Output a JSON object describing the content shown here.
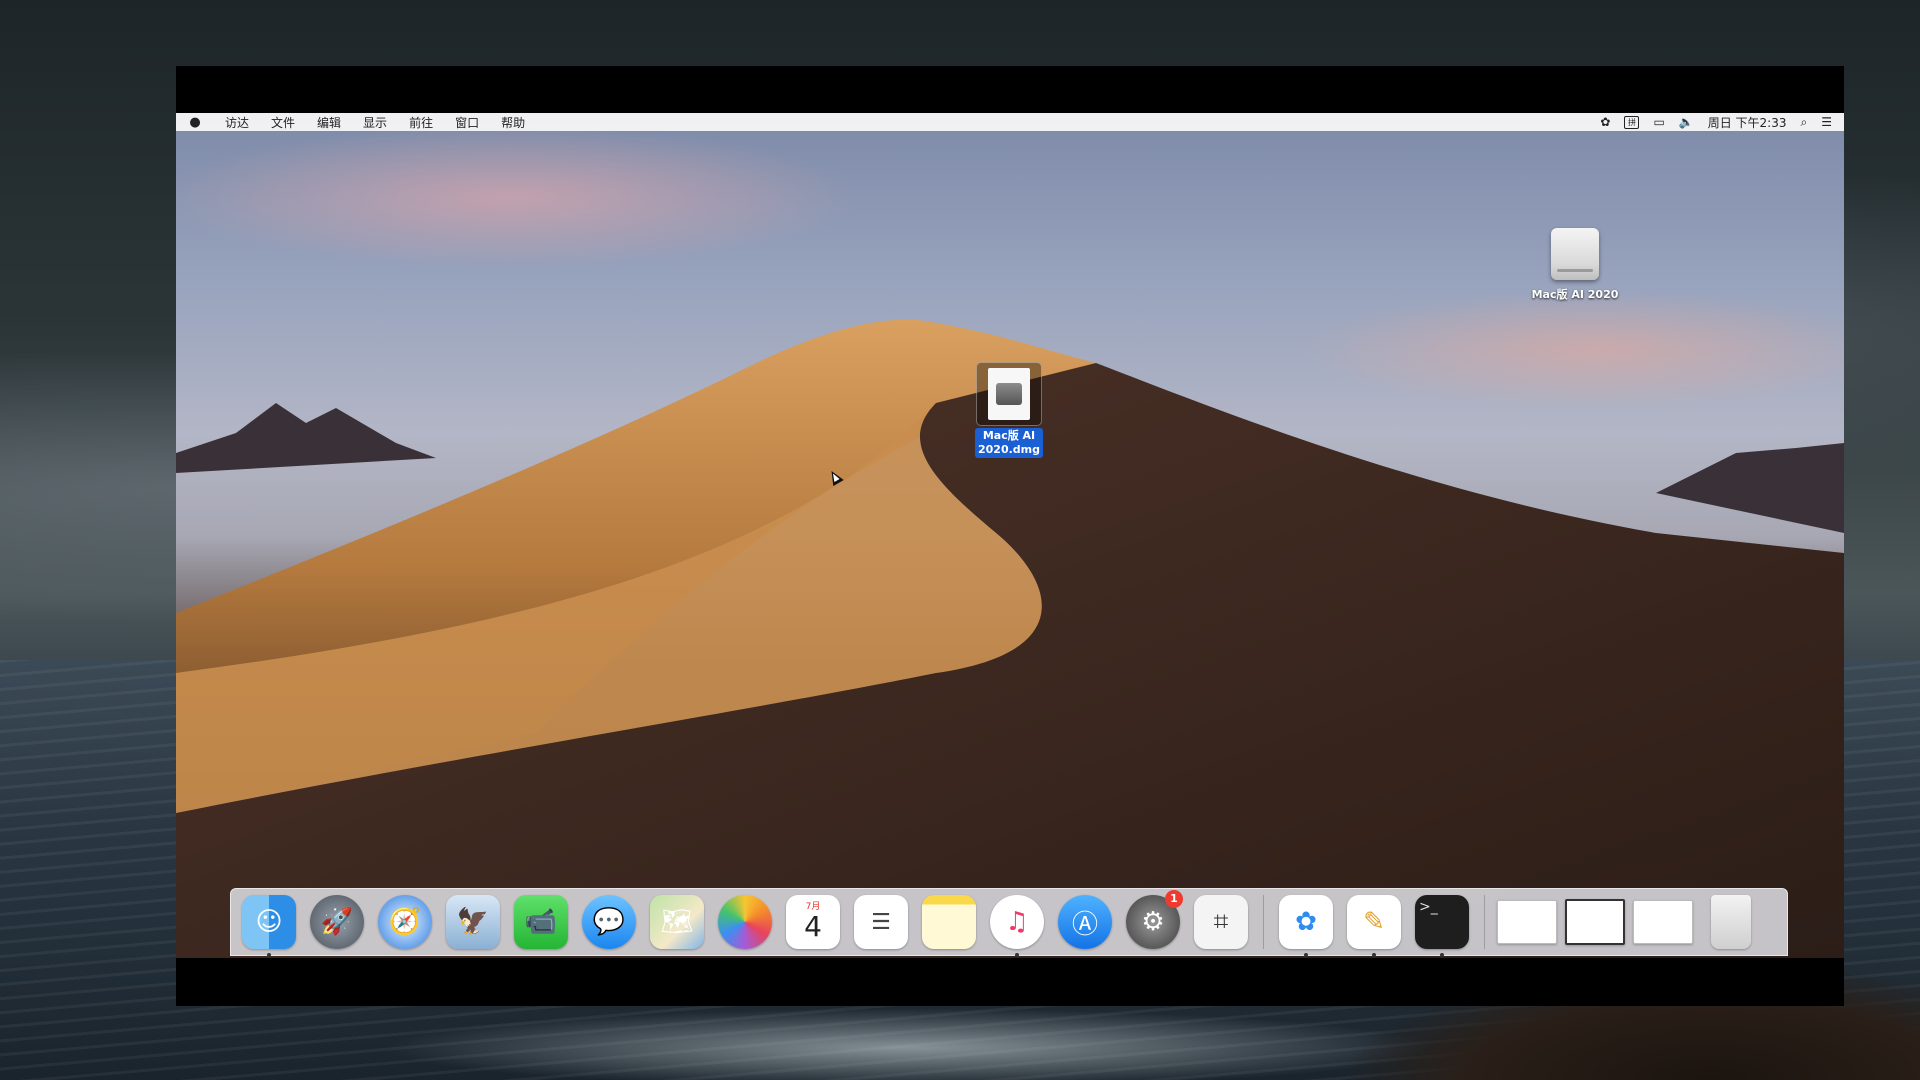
{
  "menubar": {
    "apple_icon": "",
    "items": [
      {
        "label": "访达"
      },
      {
        "label": "文件"
      },
      {
        "label": "编辑"
      },
      {
        "label": "显示"
      },
      {
        "label": "前往"
      },
      {
        "label": "窗口"
      },
      {
        "label": "帮助"
      }
    ],
    "status_icons": [
      "baidu-netdisk-icon",
      "input-method-icon",
      "display-mirroring-icon",
      "volume-icon"
    ],
    "input_method_label": "拼",
    "clock": "周日 下午2:33",
    "search_icon": "search-icon",
    "notification_center_icon": "notification-center-icon"
  },
  "desktop": {
    "drive_label": "Mac版 AI 2020",
    "dmg_label_line1": "Mac版 AI",
    "dmg_label_line2": "2020.dmg"
  },
  "dock": {
    "apps": [
      {
        "name": "Finder",
        "icon": "finder-icon",
        "running": true
      },
      {
        "name": "Launchpad",
        "icon": "launchpad-icon"
      },
      {
        "name": "Safari",
        "icon": "safari-icon"
      },
      {
        "name": "Mail",
        "icon": "mail-icon"
      },
      {
        "name": "FaceTime",
        "icon": "facetime-icon"
      },
      {
        "name": "Messages",
        "icon": "messages-icon"
      },
      {
        "name": "Maps",
        "icon": "maps-icon"
      },
      {
        "name": "Photos",
        "icon": "photos-icon"
      },
      {
        "name": "Calendar",
        "icon": "calendar-icon",
        "month": "7月",
        "day": "4"
      },
      {
        "name": "Reminders",
        "icon": "reminders-icon"
      },
      {
        "name": "Notes",
        "icon": "notes-icon"
      },
      {
        "name": "Music",
        "icon": "music-icon",
        "running": true
      },
      {
        "name": "App Store",
        "icon": "app-store-icon"
      },
      {
        "name": "System Preferences",
        "icon": "system-preferences-icon",
        "badge": "1"
      },
      {
        "name": "Screenshot",
        "icon": "screenshot-icon"
      },
      {
        "name": "Baidu Netdisk",
        "icon": "baidu-netdisk-icon",
        "running": true
      },
      {
        "name": "Script Editor",
        "icon": "script-editor-icon",
        "running": true
      },
      {
        "name": "Terminal",
        "icon": "terminal-icon",
        "running": true
      }
    ],
    "recent": [
      "window-thumbnail-1",
      "window-thumbnail-2",
      "window-thumbnail-3"
    ],
    "trash": "trash-icon"
  },
  "colors": {
    "selection": "#1a5fd4",
    "badge": "#ef3a30"
  }
}
